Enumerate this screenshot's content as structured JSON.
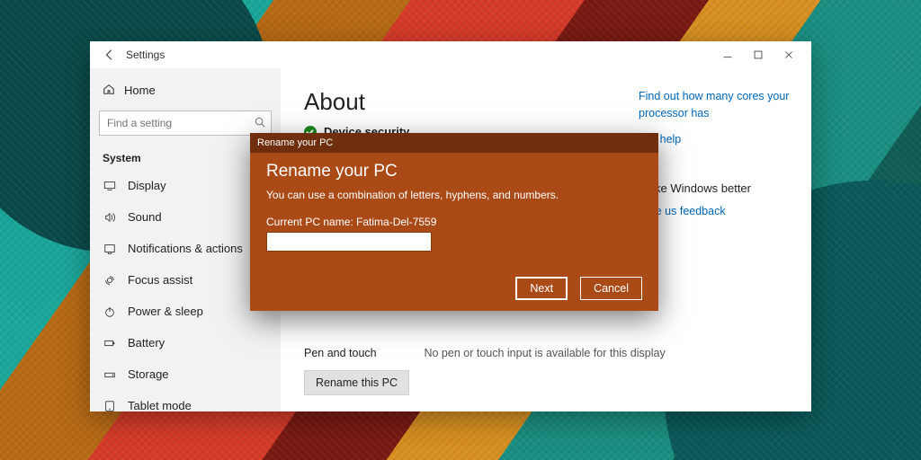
{
  "window": {
    "title": "Settings"
  },
  "sidebar": {
    "home": "Home",
    "search_placeholder": "Find a setting",
    "section": "System",
    "items": [
      {
        "icon": "display",
        "label": "Display"
      },
      {
        "icon": "sound",
        "label": "Sound"
      },
      {
        "icon": "notify",
        "label": "Notifications & actions"
      },
      {
        "icon": "focus",
        "label": "Focus assist"
      },
      {
        "icon": "power",
        "label": "Power & sleep"
      },
      {
        "icon": "battery",
        "label": "Battery"
      },
      {
        "icon": "storage",
        "label": "Storage"
      },
      {
        "icon": "tablet",
        "label": "Tablet mode"
      }
    ]
  },
  "main": {
    "heading": "About",
    "status": "Device security",
    "pen_label": "Pen and touch",
    "pen_value": "No pen or touch input is available for this display",
    "rename_button": "Rename this PC"
  },
  "rightlinks": {
    "l1": "Find out how many cores your processor has",
    "l2": "Get help",
    "subhead": "Make Windows better",
    "l3": "Give us feedback"
  },
  "dialog": {
    "titlebar": "Rename your PC",
    "heading": "Rename your PC",
    "description": "You can use a combination of letters, hyphens, and numbers.",
    "current_label": "Current PC name: Fatima-Del-7559",
    "input_value": "",
    "next": "Next",
    "cancel": "Cancel"
  }
}
